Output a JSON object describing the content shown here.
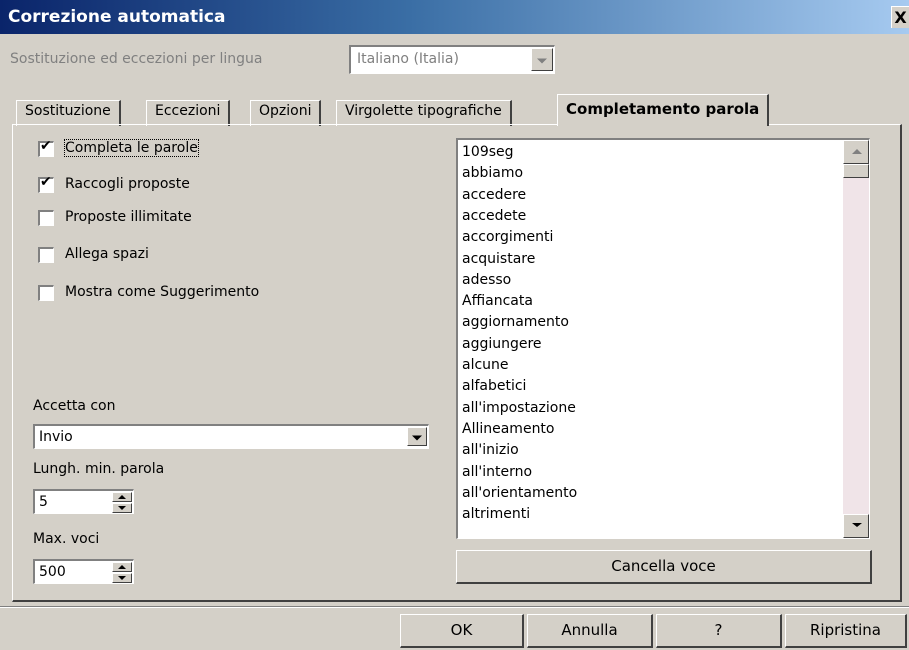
{
  "window": {
    "title": "Correzione automatica",
    "close_label": "X"
  },
  "language": {
    "label": "Sostituzione ed eccezioni per lingua",
    "selected": "Italiano (Italia)"
  },
  "tabs": [
    {
      "label": "Sostituzione"
    },
    {
      "label": "Eccezioni"
    },
    {
      "label": "Opzioni"
    },
    {
      "label": "Virgolette tipografiche"
    },
    {
      "label": "Completamento parola"
    }
  ],
  "options": [
    {
      "label": "Completa le parole",
      "checked": true
    },
    {
      "label": "Raccogli proposte",
      "checked": true
    },
    {
      "label": "Proposte illimitate",
      "checked": false
    },
    {
      "label": "Allega spazi",
      "checked": false
    },
    {
      "label": "Mostra come Suggerimento",
      "checked": false
    }
  ],
  "check_mark": "✔",
  "accept": {
    "label": "Accetta con",
    "value": "Invio"
  },
  "min_length": {
    "label": "Lungh. min. parola",
    "value": "5"
  },
  "max_entries": {
    "label": "Max. voci",
    "value": "500"
  },
  "words": [
    "109seg",
    "abbiamo",
    "accedere",
    "accedete",
    "accorgimenti",
    "acquistare",
    "adesso",
    "Affiancata",
    "aggiornamento",
    "aggiungere",
    "alcune",
    "alfabetici",
    "all'impostazione",
    "Allineamento",
    "all'inizio",
    "all'interno",
    "all'orientamento",
    "altrimenti"
  ],
  "delete_button": "Cancella voce",
  "footer": {
    "ok": "OK",
    "cancel": "Annulla",
    "help": "?",
    "reset": "Ripristina"
  }
}
